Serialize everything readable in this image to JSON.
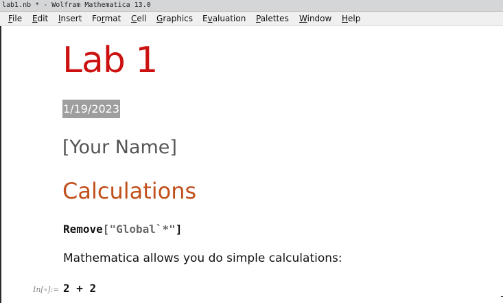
{
  "window": {
    "title": "lab1.nb * - Wolfram Mathematica 13.0"
  },
  "menubar": {
    "items": [
      {
        "label": "File",
        "u": "F",
        "rest": "ile"
      },
      {
        "label": "Edit",
        "u": "E",
        "rest": "dit"
      },
      {
        "label": "Insert",
        "u": "I",
        "rest": "nsert"
      },
      {
        "label": "Format",
        "pre": "Fo",
        "u": "r",
        "rest": "mat"
      },
      {
        "label": "Cell",
        "u": "C",
        "rest": "ell"
      },
      {
        "label": "Graphics",
        "u": "G",
        "rest": "raphics"
      },
      {
        "label": "Evaluation",
        "pre": "E",
        "u": "v",
        "rest": "aluation"
      },
      {
        "label": "Palettes",
        "u": "P",
        "rest": "alettes"
      },
      {
        "label": "Window",
        "u": "W",
        "rest": "indow"
      },
      {
        "label": "Help",
        "u": "H",
        "rest": "elp"
      }
    ]
  },
  "notebook": {
    "title": "Lab 1",
    "date": "1/19/2023",
    "author": "[Your Name]",
    "section": "Calculations",
    "code": {
      "func": "Remove",
      "open": "[",
      "string": "\"Global`*\"",
      "close": "]"
    },
    "text": "Mathematica allows you do simple calculations:",
    "input_label": "In[∘]:=",
    "input": "2 + 2"
  },
  "colors": {
    "title": "#cc1111",
    "section": "#c1501b",
    "author": "#555555",
    "selection": "#9e9e9e"
  }
}
